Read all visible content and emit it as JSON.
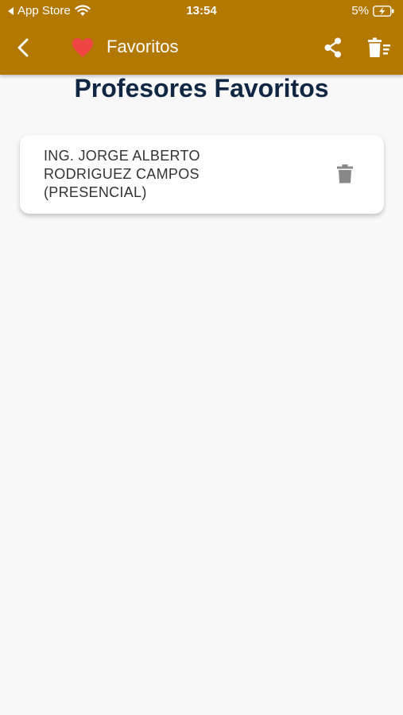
{
  "status_bar": {
    "back_app": "App Store",
    "time": "13:54",
    "battery_percent": "5%"
  },
  "app_bar": {
    "title": "Favoritos",
    "icons": [
      "back-arrow-icon",
      "heart-icon",
      "share-icon",
      "clear-all-icon"
    ],
    "background_color": "#b27800",
    "heart_color": "#ee4444"
  },
  "page": {
    "title": "Profesores Favoritos"
  },
  "favorites": [
    {
      "name_lines": [
        "ING. JORGE ALBERTO",
        "RODRIGUEZ CAMPOS",
        "(PRESENCIAL)"
      ],
      "delete_icon": "trash-icon"
    }
  ]
}
